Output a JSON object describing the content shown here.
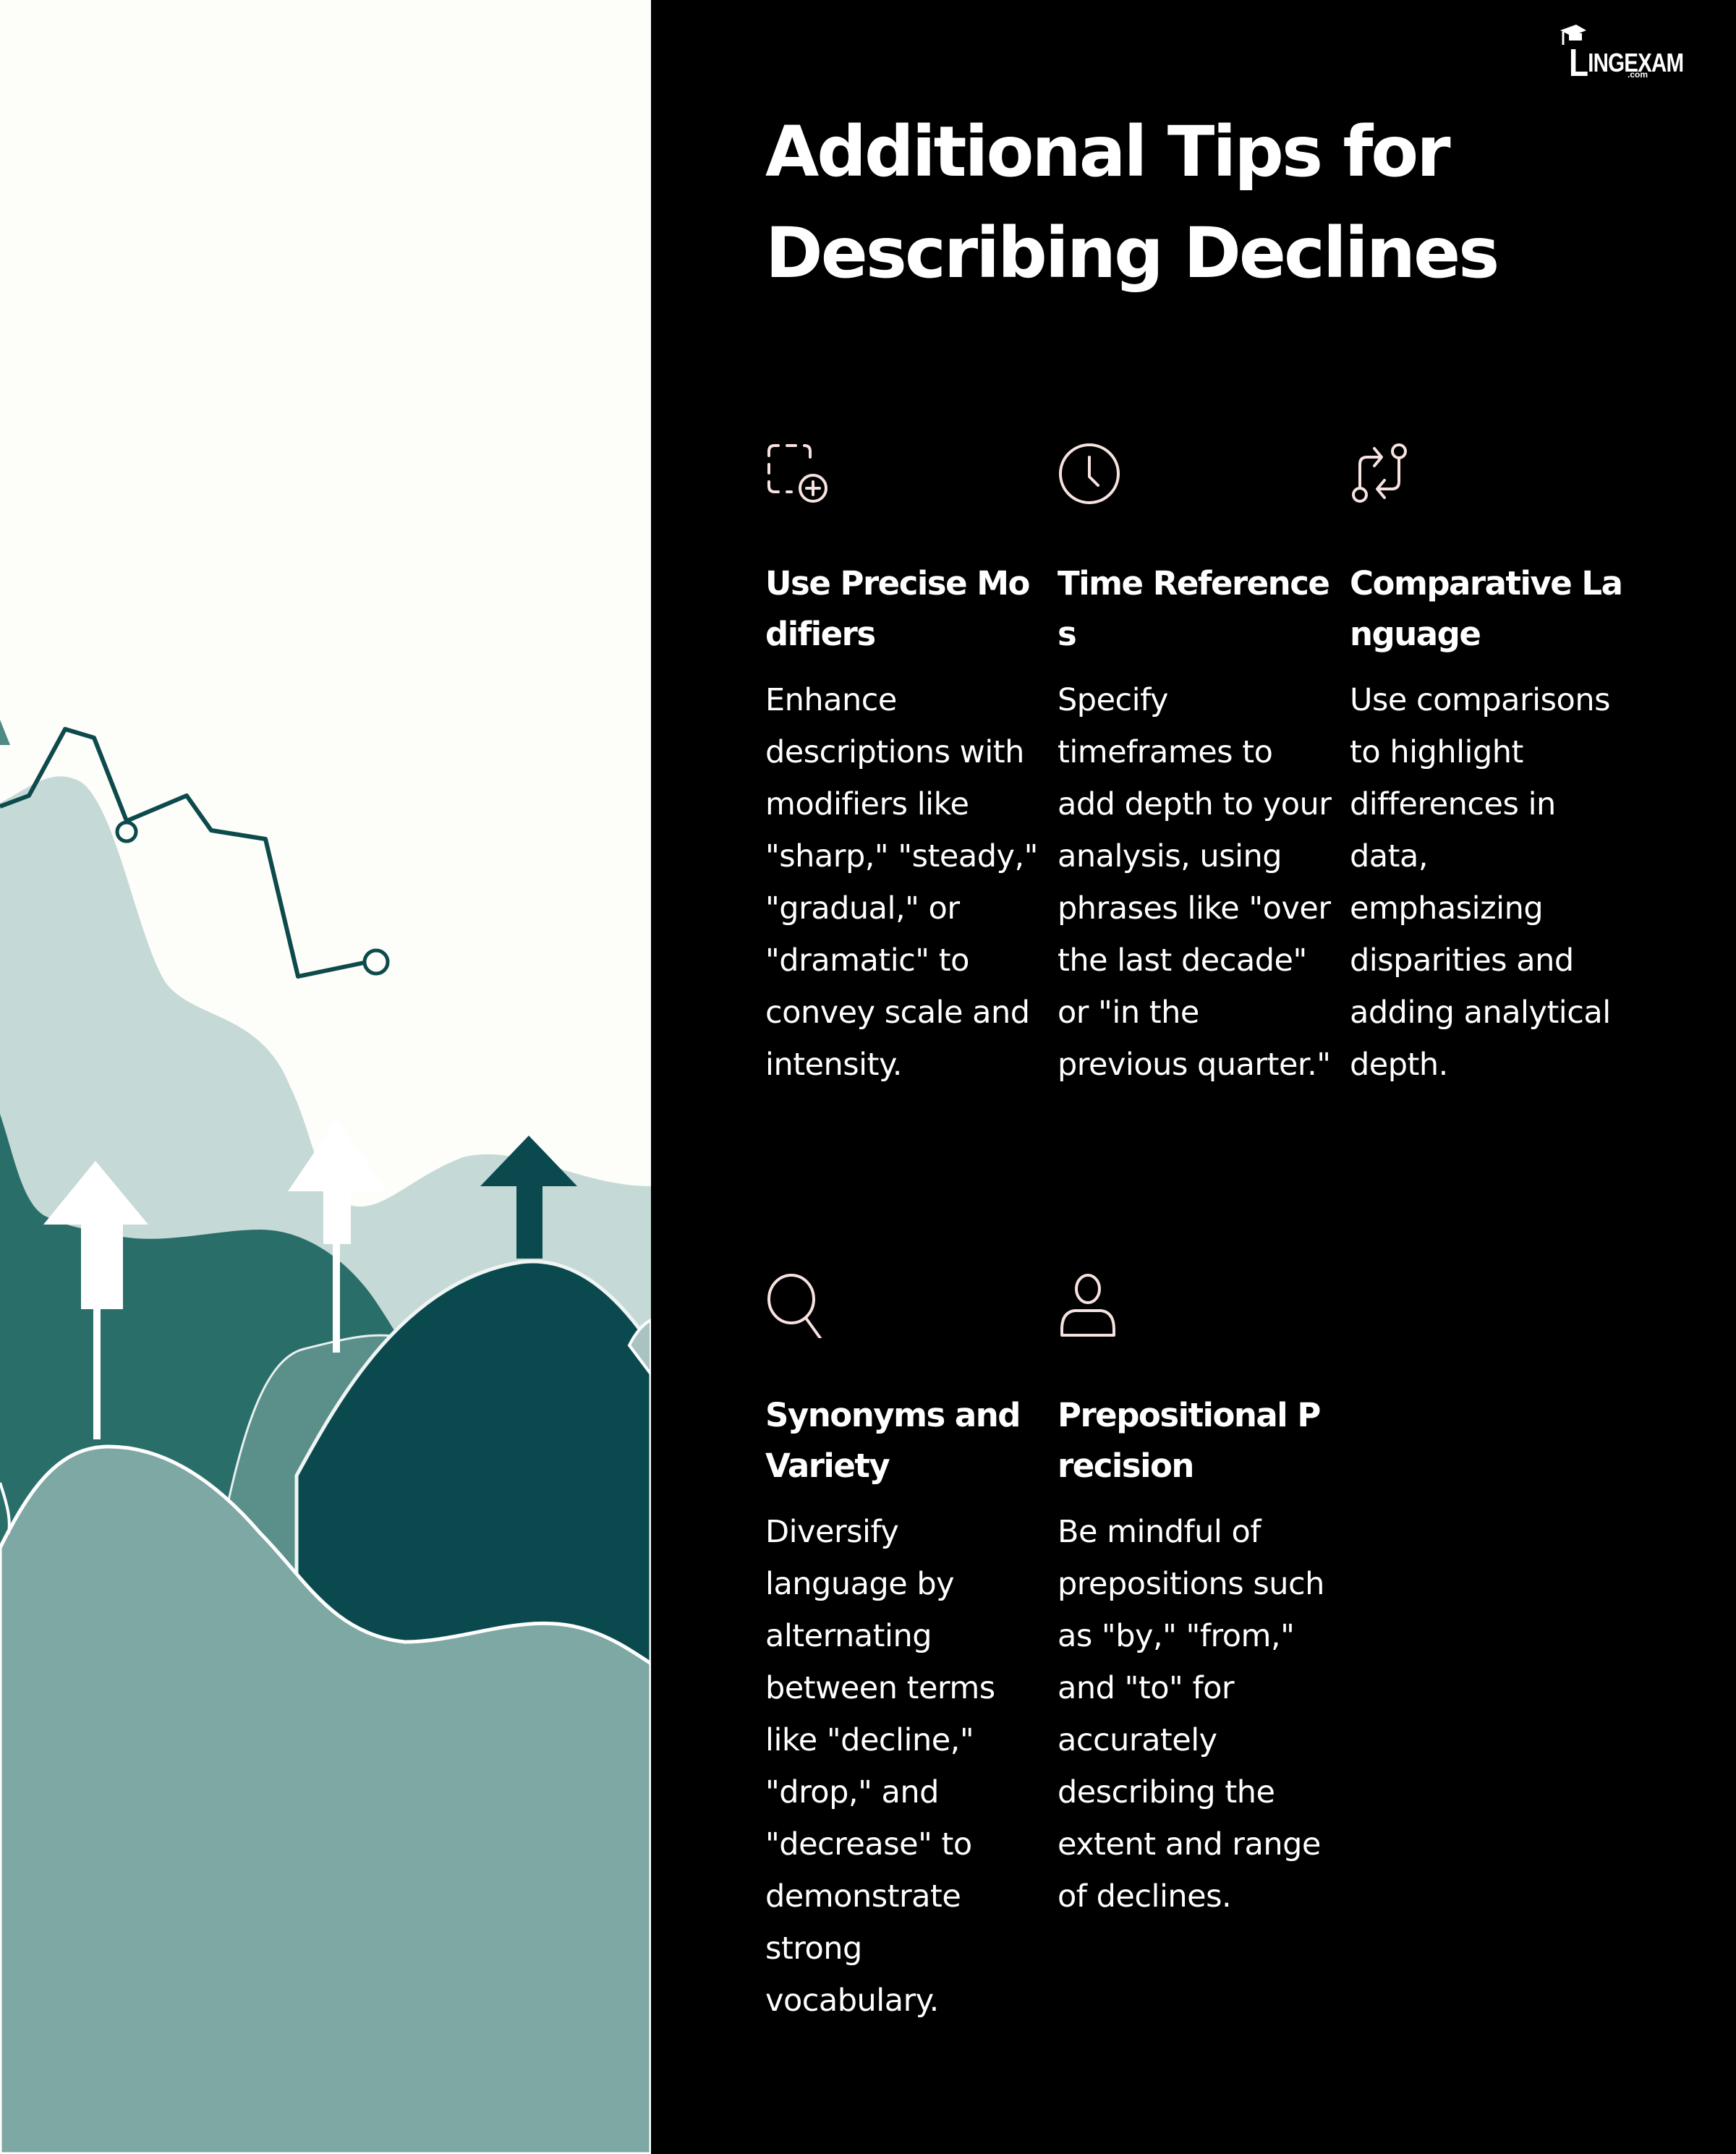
{
  "brand": {
    "logo_initial": "L",
    "logo_rest": "INGEXAM",
    "logo_domain": ".com"
  },
  "title": "Additional Tips for Describing Declines",
  "colors": {
    "icon_stroke": "#f6e2df",
    "panel_background": "#000000",
    "illustration_background": "#fdfdf9",
    "teal_dark": "#0a4a4f",
    "teal_mid": "#2a6e6a",
    "teal_light": "#c5d9d6",
    "teal_soft": "#8fb3ae"
  },
  "tips": [
    {
      "icon": "dashed-square-plus-icon",
      "heading": "Use Precise Modifiers",
      "body": "Enhance descriptions with modifiers like \"sharp,\" \"steady,\" \"gradual,\" or \"dramatic\" to convey scale and intensity."
    },
    {
      "icon": "clock-icon",
      "heading": "Time References",
      "body": "Specify timeframes to add depth to your analysis, using phrases like \"over the last decade\" or \"in the previous quarter.\""
    },
    {
      "icon": "compare-arrows-icon",
      "heading": "Comparative Language",
      "body": "Use comparisons to highlight differences in data, emphasizing disparities and adding analytical depth."
    },
    {
      "icon": "magnifier-icon",
      "heading": "Synonyms and Variety",
      "body": "Diversify language by alternating between terms like \"decline,\" \"drop,\" and \"decrease\" to demonstrate strong vocabulary."
    },
    {
      "icon": "person-icon",
      "heading": "Prepositional Precision",
      "body": "Be mindful of prepositions such as \"by,\" \"from,\" and \"to\" for accurately describing the extent and range of declines."
    }
  ]
}
